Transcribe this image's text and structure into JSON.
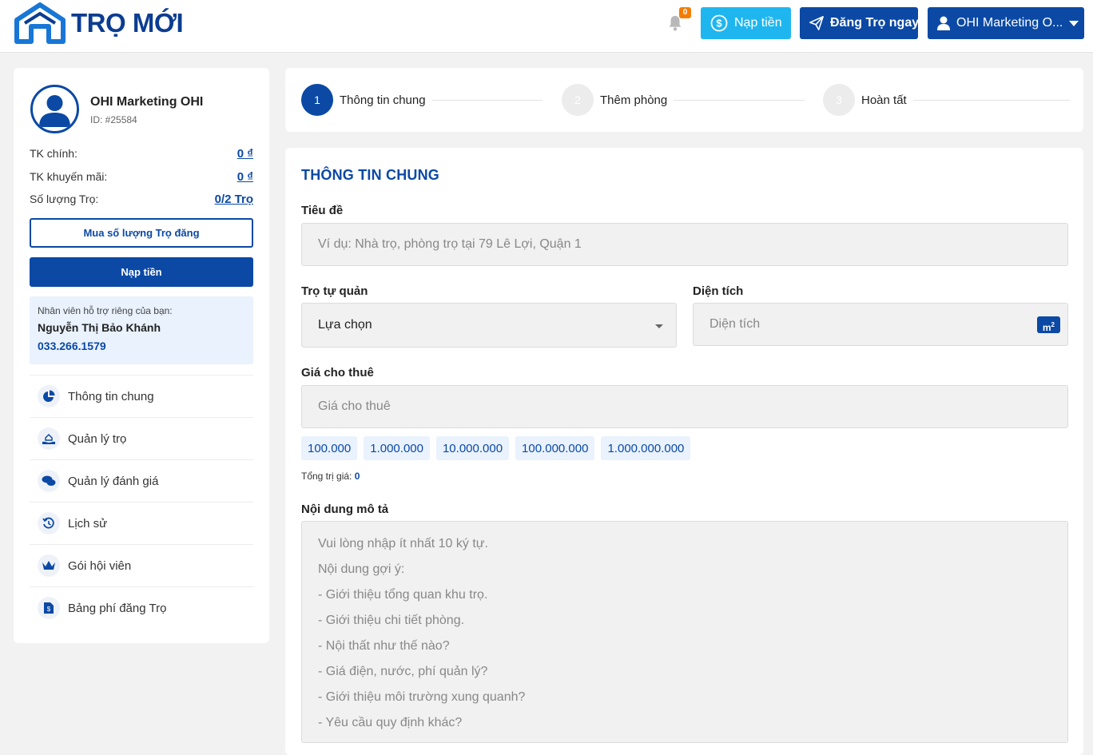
{
  "header": {
    "logo_text": "TRỌ MỚI",
    "notification_count": "0",
    "topup_label": "Nạp tiền",
    "post_label": "Đăng Trọ ngay",
    "user_label": "OHI Marketing O..."
  },
  "profile": {
    "name": "OHI Marketing OHI",
    "id": "ID: #25584",
    "stats": [
      {
        "label": "TK chính:",
        "value": "0 ₫"
      },
      {
        "label": "TK khuyến mãi:",
        "value": "0 ₫"
      },
      {
        "label": "Số lượng Trọ:",
        "value": "0/2 Trọ"
      }
    ],
    "buy_label": "Mua số lượng Trọ đăng",
    "topup_label": "Nạp tiền",
    "support": {
      "label": "Nhân viên hỗ trợ riêng của bạn:",
      "name": "Nguyễn Thị Bảo Khánh",
      "phone": "033.266.1579"
    }
  },
  "menu": [
    {
      "label": "Thông tin chung",
      "icon": "pie-chart-icon"
    },
    {
      "label": "Quản lý trọ",
      "icon": "hand-house-icon"
    },
    {
      "label": "Quản lý đánh giá",
      "icon": "comments-icon"
    },
    {
      "label": "Lịch sử",
      "icon": "history-icon"
    },
    {
      "label": "Gói hội viên",
      "icon": "crown-icon"
    },
    {
      "label": "Bảng phí đăng Trọ",
      "icon": "fee-document-icon"
    }
  ],
  "steps": [
    {
      "number": "1",
      "label": "Thông tin chung",
      "active": true
    },
    {
      "number": "2",
      "label": "Thêm phòng",
      "active": false
    },
    {
      "number": "3",
      "label": "Hoàn tất",
      "active": false
    }
  ],
  "form": {
    "section_title": "THÔNG TIN CHUNG",
    "title_label": "Tiêu đề",
    "title_placeholder": "Ví dụ: Nhà trọ, phòng trọ tại 79 Lê Lợi, Quận 1",
    "self_managed_label": "Trọ tự quản",
    "self_managed_value": "Lựa chọn",
    "area_label": "Diện tích",
    "area_placeholder": "Diện tích",
    "area_unit": "m",
    "area_unit_sup": "2",
    "price_label": "Giá cho thuê",
    "price_placeholder": "Giá cho thuê",
    "price_chips": [
      "100.000",
      "1.000.000",
      "10.000.000",
      "100.000.000",
      "1.000.000.000"
    ],
    "total_label": "Tổng trị giá:",
    "total_value": "0",
    "description_label": "Nội dung mô tả",
    "description_placeholder_lines": [
      "Vui lòng nhập ít nhất 10 ký tự.",
      "Nội dung gợi ý:",
      "- Giới thiệu tổng quan khu trọ.",
      "- Giới thiệu chi tiết phòng.",
      "- Nội thất như thế nào?",
      "- Giá điện, nước, phí quản lý?",
      "- Giới thiệu môi trường xung quanh?",
      "- Yêu cầu quy định khác?"
    ]
  }
}
